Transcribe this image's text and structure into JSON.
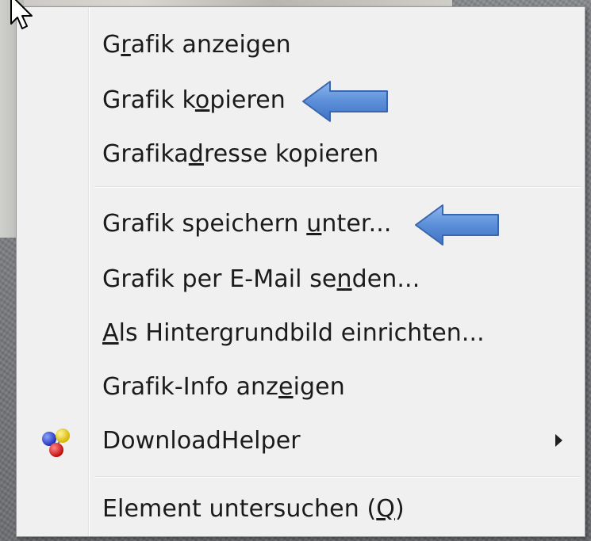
{
  "context_menu": {
    "items": [
      {
        "label": "Grafik anzeigen",
        "access_key": "r"
      },
      {
        "label": "Grafik kopieren",
        "access_key": "o"
      },
      {
        "label": "Grafikadresse kopieren",
        "access_key": "d"
      },
      {
        "label": "Grafik speichern unter...",
        "access_key": "u"
      },
      {
        "label": "Grafik per E-Mail senden...",
        "access_key": "n"
      },
      {
        "label": "Als Hintergrundbild einrichten...",
        "access_key": "A"
      },
      {
        "label": "Grafik-Info anzeigen",
        "access_key": "e"
      },
      {
        "label": "DownloadHelper",
        "icon": "downloadhelper-icon",
        "has_submenu": true
      },
      {
        "label": "Element untersuchen (Q)",
        "access_key": "Q"
      }
    ]
  },
  "annotations": {
    "arrow_color": "#5b8fd9",
    "arrow_targets": [
      "Grafik kopieren",
      "Grafik speichern unter..."
    ]
  },
  "colors": {
    "menu_background": "#f0f0f0",
    "menu_border": "#979797",
    "text": "#1b1b1b"
  }
}
